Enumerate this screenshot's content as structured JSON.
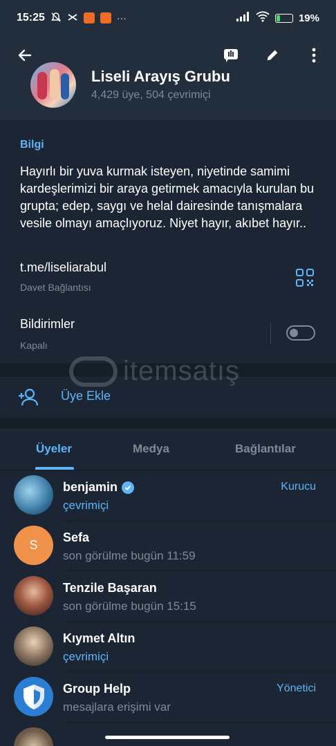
{
  "status_bar": {
    "time": "15:25",
    "dots": "···",
    "battery": "19%",
    "battery_level": 0.19
  },
  "header": {
    "group_title": "Liseli Arayış Grubu",
    "group_subtitle": "4,429 üye, 504 çevrimiçi"
  },
  "info": {
    "section_label": "Bilgi",
    "description": "Hayırlı bir yuva kurmak isteyen, niyetinde samimi kardeşlerimizi bir araya getirmek amacıyla kurulan bu grupta; edep, saygı ve helal dairesinde tanışmalara vesile olmayı amaçlıyoruz. Niyet hayır, akıbet hayır..",
    "link": "t.me/liseliarabul",
    "link_sub": "Davet Bağlantısı",
    "notifications_label": "Bildirimler",
    "notifications_sub": "Kapalı",
    "notifications_on": false
  },
  "add_member": {
    "label": "Üye Ekle"
  },
  "watermark": {
    "text": "itemsatış"
  },
  "tabs": [
    {
      "label": "Üyeler",
      "active": true
    },
    {
      "label": "Medya",
      "active": false
    },
    {
      "label": "Bağlantılar",
      "active": false
    }
  ],
  "members": [
    {
      "name": "benjamin",
      "status": "çevrimiçi",
      "online": true,
      "role": "Kurucu",
      "verified": true,
      "avatar_letter": "",
      "avatar_color": "#3f7fa8"
    },
    {
      "name": "Sefa",
      "status": "son görülme bugün 11:59",
      "online": false,
      "role": "",
      "verified": false,
      "avatar_letter": "S",
      "avatar_color": "#f0924a"
    },
    {
      "name": "Tenzile Başaran",
      "status": "son görülme bugün 15:15",
      "online": false,
      "role": "",
      "verified": false,
      "avatar_letter": "",
      "avatar_color": "#a05a44"
    },
    {
      "name": "Kıymet Altın",
      "status": "çevrimiçi",
      "online": true,
      "role": "",
      "verified": false,
      "avatar_letter": "",
      "avatar_color": "#8a7460"
    },
    {
      "name": "Group Help",
      "status": "mesajlara erişimi var",
      "online": false,
      "role": "Yönetici",
      "verified": false,
      "avatar_letter": "",
      "avatar_color": "#2a7fd4"
    }
  ],
  "colors": {
    "accent": "#5eb5f7",
    "background": "#1c2533",
    "header": "#232e3c",
    "muted": "#7d8b99"
  }
}
